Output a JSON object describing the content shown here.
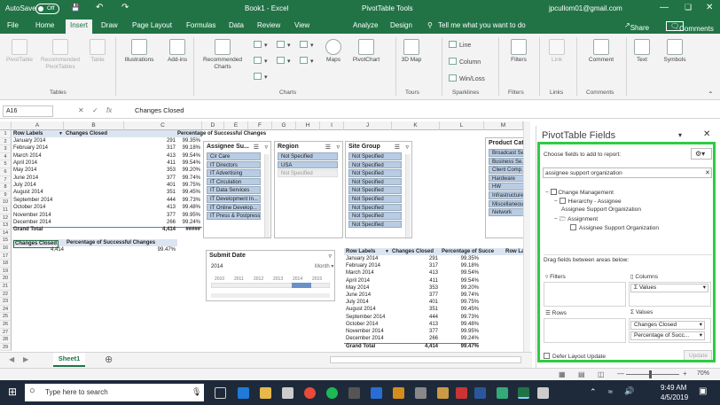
{
  "title": {
    "autosave": "AutoSave",
    "toggle": "Off",
    "book": "Book1  -  Excel",
    "context": "PivotTable Tools",
    "user": "jpcullom01@gmail.com"
  },
  "tabs": [
    "File",
    "Home",
    "Insert",
    "Draw",
    "Page Layout",
    "Formulas",
    "Data",
    "Review",
    "View",
    "Analyze",
    "Design"
  ],
  "tell_me": "Tell me what you want to do",
  "share": "Share",
  "comments": "Comments",
  "ribbon": {
    "pivot": "PivotTable",
    "recommended_pivot": "Recommended PivotTables",
    "table": "Table",
    "illustrations": "Illustrations",
    "addins": "Add-ins",
    "recommended_charts": "Recommended Charts",
    "maps": "Maps",
    "pivotchart": "PivotChart",
    "map3d": "3D Map",
    "line": "Line",
    "column": "Column",
    "winloss": "Win/Loss",
    "filters": "Filters",
    "link": "Link",
    "comment": "Comment",
    "text": "Text",
    "symbols": "Symbols",
    "groups": [
      "Tables",
      "Charts",
      "Tours",
      "Sparklines",
      "Filters",
      "Links",
      "Comments"
    ]
  },
  "formula_bar": {
    "namebox": "A16",
    "fx": "fx",
    "value": "Changes Closed"
  },
  "columns": [
    "A",
    "B",
    "C",
    "D",
    "E",
    "F",
    "G",
    "H",
    "I",
    "J",
    "K",
    "L",
    "M"
  ],
  "rows": [
    "1",
    "2",
    "3",
    "4",
    "5",
    "6",
    "7",
    "8",
    "9",
    "10",
    "11",
    "12",
    "13",
    "14",
    "15",
    "16",
    "17",
    "18",
    "19",
    "20",
    "21",
    "22",
    "23",
    "24",
    "25",
    "26",
    "27",
    "28",
    "29"
  ],
  "pivot1": {
    "headers": [
      "Row Labels",
      "Changes Closed",
      "Percentage of Successful Changes"
    ],
    "rows": [
      [
        "January 2014",
        "291",
        "99.35%"
      ],
      [
        "February 2014",
        "317",
        "99.18%"
      ],
      [
        "March 2014",
        "413",
        "99.54%"
      ],
      [
        "April 2014",
        "411",
        "99.54%"
      ],
      [
        "May 2014",
        "353",
        "99.20%"
      ],
      [
        "June 2014",
        "377",
        "99.74%"
      ],
      [
        "July 2014",
        "401",
        "99.75%"
      ],
      [
        "August 2014",
        "351",
        "99.45%"
      ],
      [
        "September 2014",
        "444",
        "99.73%"
      ],
      [
        "October 2014",
        "413",
        "99.48%"
      ],
      [
        "November 2014",
        "377",
        "99.95%"
      ],
      [
        "December 2014",
        "266",
        "99.24%"
      ]
    ],
    "total": [
      "Grand Total",
      "4,414",
      "#####"
    ]
  },
  "pivot2": {
    "headers": [
      "Changes Closed",
      "Percentage of Successful Changes"
    ],
    "values": [
      "4,414",
      "99.47%"
    ]
  },
  "pivot3": {
    "headers": [
      "Row Labels",
      "Changes Closed",
      "Percentage of Succe",
      "Row Lal"
    ],
    "rows": [
      [
        "January 2014",
        "291",
        "99.35%"
      ],
      [
        "February 2014",
        "317",
        "99.18%"
      ],
      [
        "March 2014",
        "413",
        "99.54%"
      ],
      [
        "April 2014",
        "411",
        "99.54%"
      ],
      [
        "May 2014",
        "353",
        "99.20%"
      ],
      [
        "June 2014",
        "377",
        "99.74%"
      ],
      [
        "July 2014",
        "401",
        "99.75%"
      ],
      [
        "August 2014",
        "351",
        "99.45%"
      ],
      [
        "September 2014",
        "444",
        "99.73%"
      ],
      [
        "October 2014",
        "413",
        "99.48%"
      ],
      [
        "November 2014",
        "377",
        "99.95%"
      ],
      [
        "December 2014",
        "266",
        "99.24%"
      ]
    ],
    "total": [
      "Grand Total",
      "4,414",
      "99.47%"
    ]
  },
  "slicers": {
    "assignee": {
      "title": "Assignee Su...",
      "items": [
        "Cir Care",
        "IT Directors",
        "IT Advertising",
        "IT Circulation",
        "IT Data Services",
        "IT Development In...",
        "IT Online Develop...",
        "IT Press & Postpress"
      ]
    },
    "region": {
      "title": "Region",
      "items": [
        "Not Specified",
        "USA",
        "Not Specified"
      ]
    },
    "site": {
      "title": "Site Group",
      "items": [
        "Not Specified",
        "Not Specified",
        "Not Specified",
        "Not Specified",
        "Not Specified",
        "Not Specified",
        "Not Specified",
        "Not Specified",
        "Not Specified"
      ]
    },
    "product": {
      "title": "Product Cat",
      "items": [
        "Broadcast Se...",
        "Business Se...",
        "Client Comp...",
        "Hardware",
        "HW",
        "Infrastructure",
        "Miscellaneou...",
        "Network"
      ]
    }
  },
  "timeline": {
    "title": "Submit Date",
    "period": "2014",
    "unit": "Month",
    "years": [
      "2010",
      "2011",
      "2012",
      "2013",
      "2014",
      "2015"
    ]
  },
  "sheet": "Sheet1",
  "panel": {
    "title": "PivotTable Fields",
    "choose": "Choose fields to add to report:",
    "search": "assignee support organization",
    "tree": [
      "Change Management",
      "Hierarchy - Assignee",
      "Assignee Support Organization",
      "Assignment",
      "Assignee Support Organization"
    ],
    "drag": "Drag fields between areas below:",
    "filters": "Filters",
    "columns": "Columns",
    "columns_chip": "Σ Values",
    "rows": "Rows",
    "values": "Σ Values",
    "values_chips": [
      "Changes Closed",
      "Percentage of Succ..."
    ],
    "defer": "Defer Layout Update",
    "update": "Update"
  },
  "status": {
    "zoom": "70%"
  },
  "taskbar": {
    "search": "Type here to search",
    "time": "9:49 AM",
    "date": "4/5/2019"
  }
}
